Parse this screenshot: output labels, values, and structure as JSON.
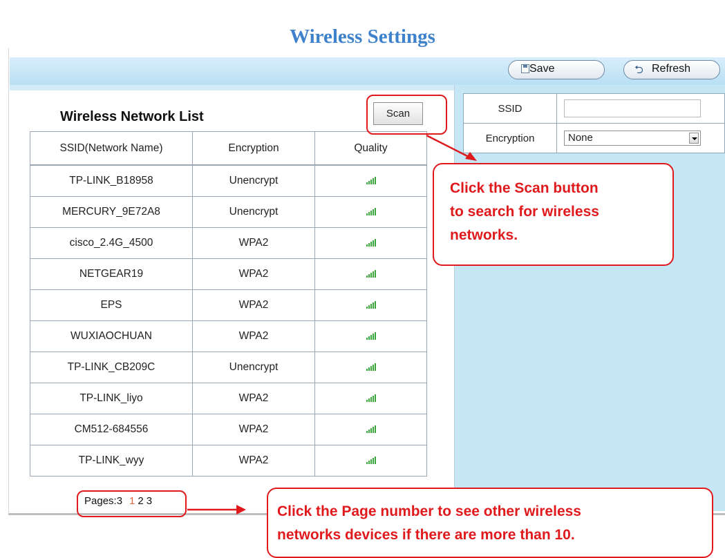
{
  "header": {
    "title": "Wireless Settings"
  },
  "toolbar": {
    "save_label": "Save",
    "refresh_label": "Refresh"
  },
  "network_list": {
    "title": "Wireless Network List",
    "scan_label": "Scan",
    "columns": [
      "SSID(Network Name)",
      "Encryption",
      "Quality"
    ],
    "rows": [
      {
        "ssid": "TP-LINK_B18958",
        "encryption": "Unencrypt"
      },
      {
        "ssid": "MERCURY_9E72A8",
        "encryption": "Unencrypt"
      },
      {
        "ssid": "cisco_2.4G_4500",
        "encryption": "WPA2"
      },
      {
        "ssid": "NETGEAR19",
        "encryption": "WPA2"
      },
      {
        "ssid": "EPS",
        "encryption": "WPA2"
      },
      {
        "ssid": "WUXIAOCHUAN",
        "encryption": "WPA2"
      },
      {
        "ssid": "TP-LINK_CB209C",
        "encryption": "Unencrypt"
      },
      {
        "ssid": "TP-LINK_liyo",
        "encryption": "WPA2"
      },
      {
        "ssid": "CM512-684556",
        "encryption": "WPA2"
      },
      {
        "ssid": "TP-LINK_wyy",
        "encryption": "WPA2"
      }
    ],
    "pagination": {
      "label": "Pages:3",
      "pages": [
        "1",
        "2",
        "3"
      ],
      "current": "1"
    }
  },
  "form": {
    "ssid_label": "SSID",
    "ssid_value": "",
    "encryption_label": "Encryption",
    "encryption_value": "None"
  },
  "annotations": {
    "scan_callout_lines": [
      "Click the Scan button",
      "to search for wireless",
      "networks."
    ],
    "page_callout_lines": [
      "Click the Page number to see other wireless",
      "networks devices if there are more than 10."
    ]
  },
  "colors": {
    "title": "#3f82cc",
    "callout": "#e0191d",
    "toolbar": "#c5e7f5",
    "active_page": "#e5663b",
    "signal": "#3aa53a"
  }
}
